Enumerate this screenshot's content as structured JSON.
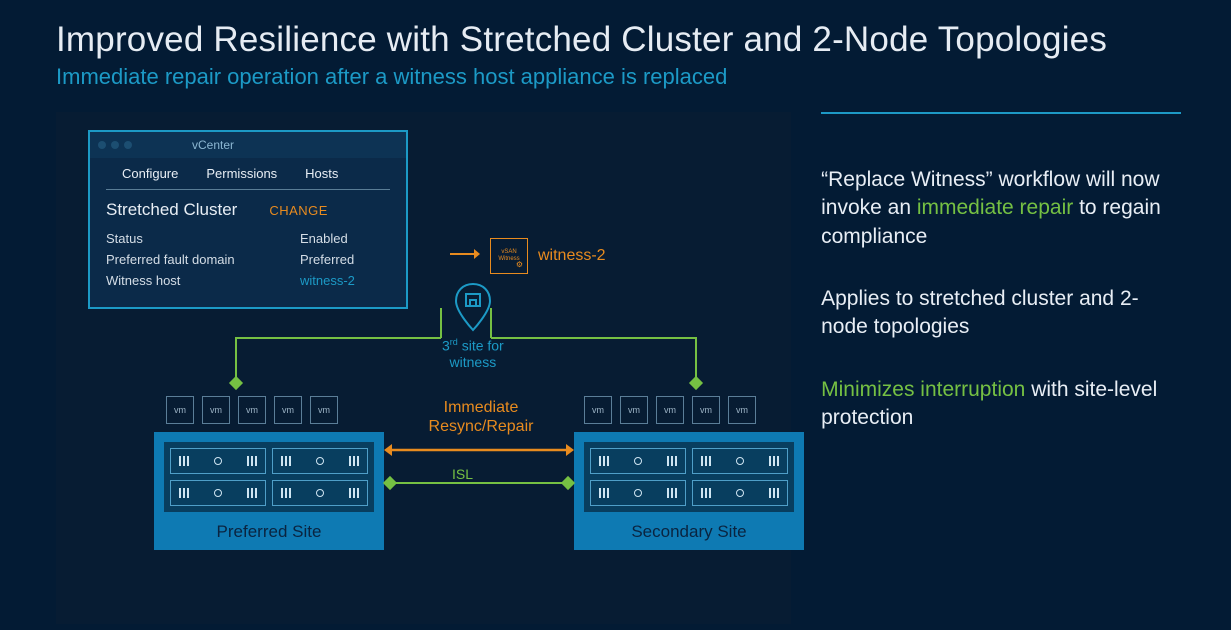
{
  "title": "Improved Resilience with Stretched Cluster and 2-Node Topologies",
  "subtitle": "Immediate repair operation after a witness host appliance is replaced",
  "vcenter": {
    "window_title": "vCenter",
    "tabs": [
      "Configure",
      "Permissions",
      "Hosts"
    ],
    "section_title": "Stretched Cluster",
    "change_label": "CHANGE",
    "rows": [
      {
        "label": "Status",
        "value": "Enabled"
      },
      {
        "label": "Preferred fault domain",
        "value": "Preferred"
      },
      {
        "label": "Witness host",
        "value": "witness-2",
        "blue": true
      }
    ]
  },
  "witness": {
    "box_line1": "vSAN",
    "box_line2": "Witness",
    "label": "witness-2"
  },
  "pin_label_html": "3",
  "pin_label_sup": "rd",
  "pin_label_rest": " site for",
  "pin_label_line2": "witness",
  "vm_label": "vm",
  "sites": {
    "preferred": "Preferred Site",
    "secondary": "Secondary Site"
  },
  "middle": {
    "line1": "Immediate",
    "line2": "Resync/Repair",
    "isl": "ISL"
  },
  "bullets": {
    "p1a": "“Replace Witness” workflow will now invoke an ",
    "p1hl": "immediate repair",
    "p1b": " to regain compliance",
    "p2": "Applies to stretched cluster and 2-node topologies",
    "p3hl": "Minimizes interruption",
    "p3b": " with site-level protection"
  }
}
